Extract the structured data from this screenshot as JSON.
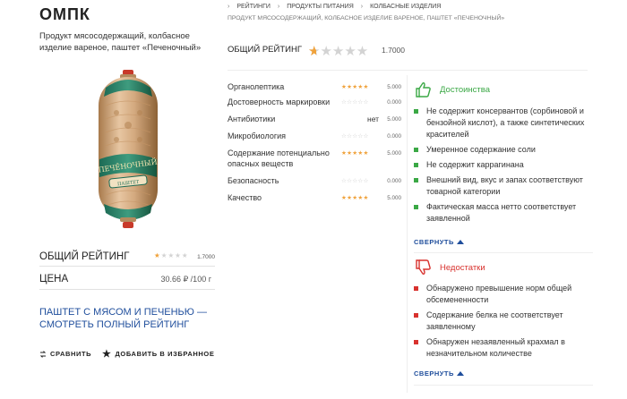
{
  "product": {
    "brand": "ОМПК",
    "description": "Продукт мясосодержащий, колбасное изделие вареное, паштет «Печеночный»",
    "label_text": "ПЕЧЁНОЧНЫЙ",
    "label_sub": "ПАШТЕТ"
  },
  "left_panel": {
    "rating_label": "ОБЩИЙ РЕЙТИНГ",
    "rating_stars": "★★★★★",
    "rating_value": "1.7000",
    "price_label": "ЦЕНА",
    "price_value": "30.66 ₽ /100 г",
    "full_rating_link": "ПАШТЕТ С МЯСОМ И ПЕЧЕНЬЮ — СМОТРЕТЬ ПОЛНЫЙ РЕЙТИНГ",
    "compare_label": "СРАВНИТЬ",
    "favorite_label": "ДОБАВИТЬ В ИЗБРАННОЕ"
  },
  "breadcrumbs": {
    "items": [
      "РЕЙТИНГИ",
      "ПРОДУКТЫ ПИТАНИЯ",
      "КОЛБАСНЫЕ ИЗДЕЛИЯ"
    ],
    "separator": "›",
    "current": "ПРОДУКТ МЯСОСОДЕРЖАЩИЙ, КОЛБАСНОЕ ИЗДЕЛИЕ ВАРЕНОЕ, ПАШТЕТ «ПЕЧЕНОЧНЫЙ»"
  },
  "overall": {
    "label": "ОБЩИЙ РЕЙТИНГ",
    "stars": "★★★★★",
    "value": "1.7000",
    "rating": 1.7
  },
  "criteria": [
    {
      "name": "Органолептика",
      "stars": "★★★★★",
      "filled": 5,
      "value": "5.000"
    },
    {
      "name": "Достоверность маркировки",
      "stars": "☆☆☆☆☆",
      "filled": 0,
      "value": "0.000"
    },
    {
      "name": "Антибиотики",
      "text_value": "нет",
      "value": "5.000"
    },
    {
      "name": "Микробиология",
      "stars": "☆☆☆☆☆",
      "filled": 0,
      "value": "0.000"
    },
    {
      "name": "Содержание потенциально опасных веществ",
      "stars": "★★★★★",
      "filled": 5,
      "value": "5.000"
    },
    {
      "name": "Безопасность",
      "stars": "☆☆☆☆☆",
      "filled": 0,
      "value": "0.000"
    },
    {
      "name": "Качество",
      "stars": "★★★★★",
      "filled": 5,
      "value": "5.000"
    }
  ],
  "pros": {
    "title": "Достоинства",
    "items": [
      "Не содержит консервантов (сорбиновой и бензойной кислот), а также синтетических красителей",
      "Умеренное содержание соли",
      "Не содержит каррагинана",
      "Внешний вид, вкус и запах соответствуют товарной категории",
      "Фактическая масса нетто соответствует заявленной"
    ],
    "collapse_label": "СВЕРНУТЬ"
  },
  "cons": {
    "title": "Недостатки",
    "items": [
      "Обнаружено превышение норм общей обсемененности",
      "Содержание белка не соответствует заявленному",
      "Обнаружен незаявленный крахмал в незначительном количестве"
    ],
    "collapse_label": "СВЕРНУТЬ"
  },
  "colors": {
    "star_filled": "#f0a23b",
    "star_empty": "#c9c9c9",
    "link": "#1f4e9c",
    "pros_green": "#3aa845",
    "cons_red": "#d8322e"
  },
  "icons": {
    "compare": "compare-icon",
    "favorite": "star-icon",
    "pros": "thumbs-up-icon",
    "cons": "thumbs-down-icon",
    "collapse": "triangle-up-icon"
  }
}
